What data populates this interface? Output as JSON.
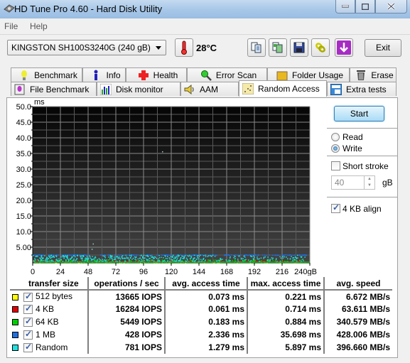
{
  "window": {
    "title": "HD Tune Pro 4.60 - Hard Disk Utility",
    "minimize_label": "–",
    "maximize_label": "□",
    "close_label": "X"
  },
  "menu": {
    "items": [
      "File",
      "Help"
    ]
  },
  "toolbar": {
    "drive": "KINGSTON SH100S3240G (240 gB)",
    "temperature": "28°C",
    "buttons": [
      "copy-text-icon",
      "copy-screenshot-icon",
      "save-icon",
      "options-icon",
      "download-icon"
    ],
    "exit_label": "Exit"
  },
  "tabs": {
    "row1": [
      {
        "label": "Benchmark",
        "icon": "lightbulb-icon"
      },
      {
        "label": "Info",
        "icon": "info-icon"
      },
      {
        "label": "Health",
        "icon": "health-cross-icon"
      },
      {
        "label": "Error Scan",
        "icon": "magnifier-icon"
      },
      {
        "label": "Folder Usage",
        "icon": "folder-icon"
      },
      {
        "label": "Erase",
        "icon": "trash-icon"
      }
    ],
    "row2": [
      {
        "label": "File Benchmark",
        "icon": "file-bulb-icon"
      },
      {
        "label": "Disk monitor",
        "icon": "bar-chart-icon"
      },
      {
        "label": "AAM",
        "icon": "speaker-icon"
      },
      {
        "label": "Random Access",
        "icon": "scatter-icon",
        "active": true
      },
      {
        "label": "Extra tests",
        "icon": "calculator-icon"
      }
    ]
  },
  "controls": {
    "start_label": "Start",
    "mode_options": [
      {
        "label": "Read",
        "selected": false
      },
      {
        "label": "Write",
        "selected": true
      }
    ],
    "short_stroke_label": "Short stroke",
    "short_stroke_checked": false,
    "short_stroke_value": "40",
    "short_stroke_unit": "gB",
    "align_label": "4 KB align",
    "align_checked": true
  },
  "chart_data": {
    "type": "scatter",
    "title": "",
    "ylabel": "ms",
    "xlabel": "gB",
    "ylim": [
      0,
      50
    ],
    "xlim": [
      0,
      240
    ],
    "y_ticks": [
      "50.0",
      "45.0",
      "40.0",
      "35.0",
      "30.0",
      "25.0",
      "20.0",
      "15.0",
      "10.0",
      "5.00"
    ],
    "x_ticks": [
      "0",
      "24",
      "48",
      "72",
      "96",
      "120",
      "144",
      "168",
      "192",
      "216",
      "240gB"
    ],
    "grid": true,
    "series": [
      {
        "name": "512 bytes",
        "color": "#f0f000",
        "band_ms": [
          0.05,
          0.22
        ]
      },
      {
        "name": "4 KB",
        "color": "#e00000",
        "band_ms": [
          0.05,
          0.71
        ]
      },
      {
        "name": "64 KB",
        "color": "#00d000",
        "band_ms": [
          0.15,
          0.88
        ]
      },
      {
        "name": "1 MB",
        "color": "#1e6fe0",
        "band_ms": [
          2.3,
          2.5
        ]
      },
      {
        "name": "Random",
        "color": "#20e0e0",
        "band_ms": [
          0.3,
          2.4
        ]
      }
    ],
    "outliers": [
      {
        "x": 52,
        "y": 6.2
      },
      {
        "x": 51,
        "y": 4.5
      },
      {
        "x": 112,
        "y": 35.7
      }
    ]
  },
  "results": {
    "headers": [
      "transfer size",
      "operations / sec",
      "avg. access time",
      "max. access time",
      "avg. speed"
    ],
    "rows": [
      {
        "color": "#ffff00",
        "label": "512 bytes",
        "checked": true,
        "ops": "13665 IOPS",
        "avg": "0.073 ms",
        "max": "0.221 ms",
        "speed": "6.672 MB/s"
      },
      {
        "color": "#e00000",
        "label": "4 KB",
        "checked": true,
        "ops": "16284 IOPS",
        "avg": "0.061 ms",
        "max": "0.714 ms",
        "speed": "63.611 MB/s"
      },
      {
        "color": "#00d000",
        "label": "64 KB",
        "checked": true,
        "ops": "5449 IOPS",
        "avg": "0.183 ms",
        "max": "0.884 ms",
        "speed": "340.579 MB/s"
      },
      {
        "color": "#1e6fe0",
        "label": "1 MB",
        "checked": true,
        "ops": "428 IOPS",
        "avg": "2.336 ms",
        "max": "35.698 ms",
        "speed": "428.006 MB/s"
      },
      {
        "color": "#20e0e0",
        "label": "Random",
        "checked": true,
        "ops": "781 IOPS",
        "avg": "1.279 ms",
        "max": "5.897 ms",
        "speed": "396.660 MB/s"
      }
    ]
  }
}
